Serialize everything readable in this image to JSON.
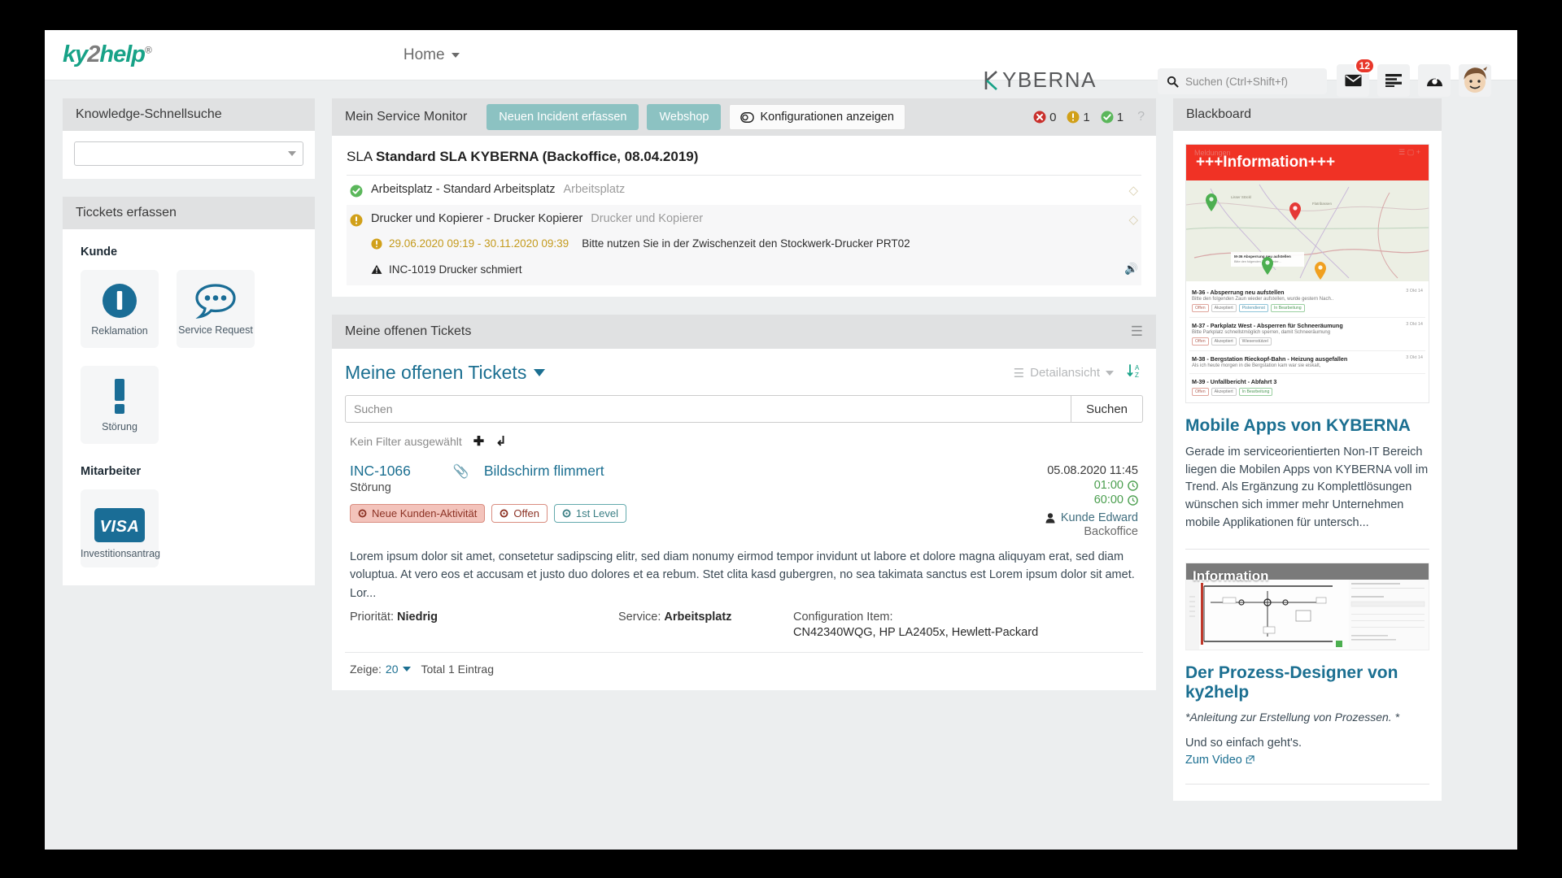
{
  "header": {
    "logo_ky": "ky",
    "logo_2": "2",
    "logo_help": "help",
    "logo_reg": "®",
    "nav_home": "Home",
    "brand": "KYBERNA",
    "brand_k": "K",
    "brand_rest": "YBERNA",
    "search_placeholder": "Suchen (Ctrl+Shift+f)",
    "mail_badge": "12",
    "icons": [
      "mail-icon",
      "list-icon",
      "dashboard-icon",
      "avatar"
    ]
  },
  "left": {
    "knowledge_title": "Knowledge-Schnellsuche",
    "knowledge_value": "",
    "tickets_title": "Ticckets erfassen",
    "group_kunde": "Kunde",
    "group_mitarbeiter": "Mitarbeiter",
    "tiles_kunde": [
      {
        "label": "Reklamation",
        "icon": "exclamation-circle-icon"
      },
      {
        "label": "Service Request",
        "icon": "speech-bubble-icon"
      },
      {
        "label": "Störung",
        "icon": "exclamation-mark-icon"
      }
    ],
    "tiles_mitarbeiter": [
      {
        "label": "Investitionsantrag",
        "icon": "visa-card-icon"
      }
    ]
  },
  "monitor": {
    "title": "Mein Service Monitor",
    "btn_new_incident": "Neuen Incident erfassen",
    "btn_webshop": "Webshop",
    "btn_configurations": "Konfigurationen anzeigen",
    "count_error": "0",
    "count_warning": "1",
    "count_ok": "1",
    "help": "?",
    "sla_prefix": "SLA",
    "sla_name": "Standard SLA KYBERNA (Backoffice, 08.04.2019)",
    "rows": [
      {
        "status": "ok",
        "text": "Arbeitsplatz - Standard Arbeitsplatz",
        "muted": "Arbeitsplatz"
      },
      {
        "status": "warning",
        "text": "Drucker und Kopierer - Drucker Kopierer",
        "muted": "Drucker und Kopierer",
        "sub_date": "29.06.2020 09:19 - 30.11.2020 09:39",
        "sub_info": "Bitte nutzen Sie in der Zwischenzeit den Stockwerk-Drucker PRT02",
        "sub2": "INC-1019 Drucker schmiert"
      }
    ]
  },
  "tickets": {
    "panel_title": "Meine offenen Tickets",
    "list_title": "Meine offenen Tickets",
    "detail_view": "Detailansicht",
    "search_placeholder": "Suchen",
    "search_button": "Suchen",
    "filter_label": "Kein Filter ausgewählt",
    "items": [
      {
        "id": "INC-1066",
        "subject": "Bildschirm flimmert",
        "type": "Störung",
        "chips": [
          {
            "label": "Neue Kunden-Aktivität",
            "style": "filled"
          },
          {
            "label": "Offen",
            "style": "outline-red"
          },
          {
            "label": "1st Level",
            "style": "outline-teal"
          }
        ],
        "date": "05.08.2020 11:45",
        "time1": "01:00",
        "time2": "60:00",
        "person": "Kunde Edward",
        "org": "Backoffice",
        "description": "Lorem ipsum dolor sit amet, consetetur sadipscing elitr, sed diam nonumy eirmod tempor invidunt ut labore et dolore magna aliquyam erat, sed diam voluptua. At vero eos et accusam et justo duo dolores et ea rebum. Stet clita kasd gubergren, no sea takimata sanctus est Lorem ipsum dolor sit amet. Lor...",
        "priority_label": "Priorität:",
        "priority_value": "Niedrig",
        "service_label": "Service:",
        "service_value": "Arbeitsplatz",
        "ci_label": "Configuration Item:",
        "ci_value": "CN42340WQG, HP LA2405x, Hewlett-Packard"
      }
    ],
    "footer_show": "Zeige:",
    "footer_count": "20",
    "footer_total": "Total 1 Eintrag"
  },
  "blackboard": {
    "title": "Blackboard",
    "banner": "+++Information+++",
    "thumb_ghost_left": "Meldungen",
    "thumb_items": [
      {
        "title": "M-36 - Absperrung neu aufstellen",
        "sub": "Bitte den folgenden Zaun wieder aufstellen, wurde gestern Nach..",
        "date": "3 Okt 14",
        "chips": [
          "Offen",
          "Akzeptiert",
          "Pistendienst",
          "In Bearbeitung"
        ]
      },
      {
        "title": "M-37 - Parkplatz West - Absperren für Schneeräumung",
        "sub": "Bitte Parkplatz schnellstmöglich sperren, damit Schneeräumung",
        "date": "3 Okt 14",
        "chips": [
          "Offen",
          "Akzeptiert",
          "Wiesenstützel"
        ]
      },
      {
        "title": "M-38 - Bergstation Rieckopf-Bahn - Heizung ausgefallen",
        "sub": "Als ich heute morgen in die Bergstation kam war sie eiskalt,",
        "date": "3 Okt 14",
        "chips": [
          "Offen",
          "Akzeptiert",
          "In Bearbeitung"
        ]
      },
      {
        "title": "M-39 - Unfallbericht - Abfahrt 3",
        "sub": "",
        "date": "",
        "chips": [
          "Offen",
          "Akzeptiert",
          "In Bearbeitung"
        ]
      }
    ],
    "post1_title": "Mobile Apps von KYBERNA",
    "post1_body": "Gerade im serviceorientierten Non-IT Bereich liegen die Mobilen Apps von KYBERNA voll im Trend. Als Ergänzung zu Komplettlösungen wünschen sich immer mehr Unternehmen mobile Applikationen für untersch...",
    "thumb2_overlay": "Information",
    "post2_title": "Der Prozess-Designer von ky2help",
    "post2_italic": "*Anleitung zur Erstellung von Prozessen. *",
    "post2_body": "Und so einfach geht's.",
    "post2_link": "Zum Video"
  },
  "colors": {
    "accent_teal": "#17a287",
    "link_blue": "#1b6f91",
    "button_teal": "#8cc2c2",
    "banner_red": "#f03225",
    "badge_red": "#e8372a",
    "status_ok": "#5bb75b",
    "status_warn": "#d1a019",
    "status_error": "#c9302c"
  }
}
